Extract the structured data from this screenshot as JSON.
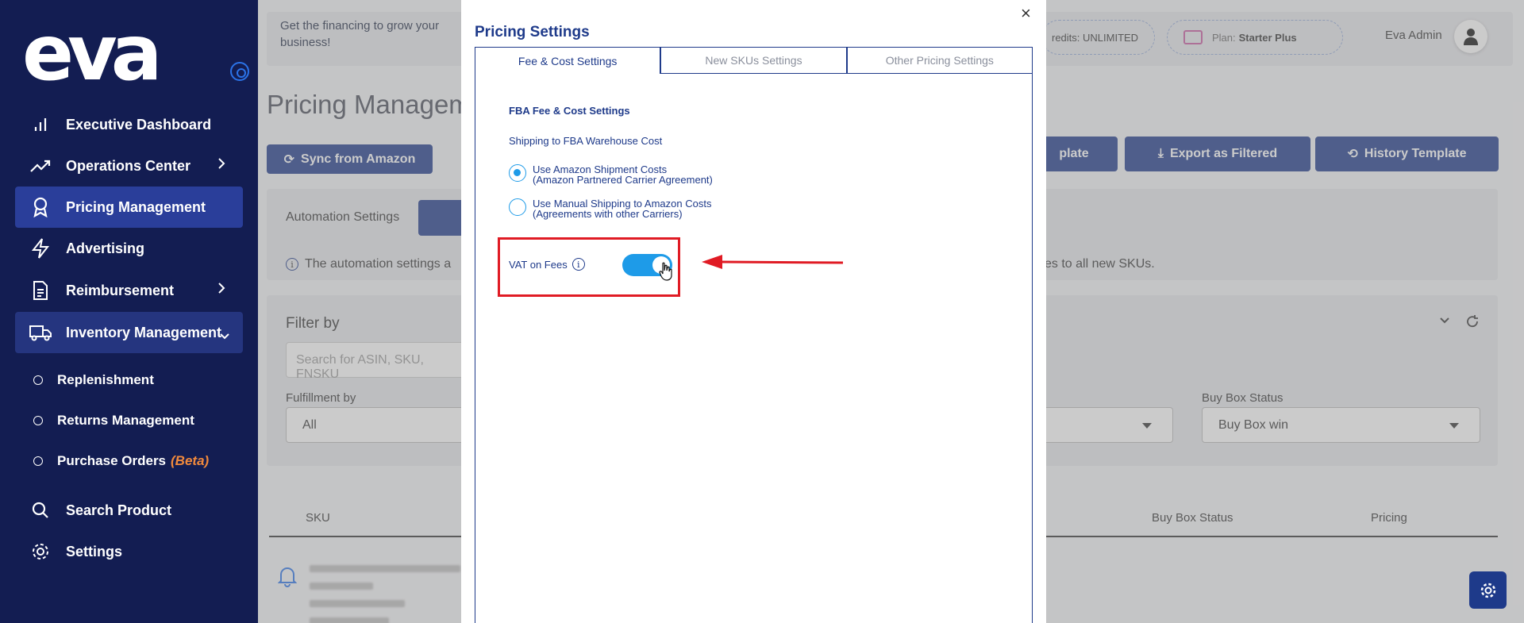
{
  "sidebar": {
    "logo_text": "eva",
    "items": [
      {
        "label": "Executive Dashboard",
        "icon": "bar-chart-icon"
      },
      {
        "label": "Operations Center",
        "icon": "trend-icon"
      },
      {
        "label": "Pricing Management",
        "icon": "award-icon"
      },
      {
        "label": "Advertising",
        "icon": "lightning-icon"
      },
      {
        "label": "Reimbursement",
        "icon": "document-icon"
      },
      {
        "label": "Inventory Management",
        "icon": "truck-icon"
      }
    ],
    "sub_items": [
      {
        "label": "Replenishment"
      },
      {
        "label": "Returns Management"
      },
      {
        "label": "Purchase Orders",
        "badge": "(Beta)"
      }
    ],
    "bottom_items": [
      {
        "label": "Search Product",
        "icon": "search-icon"
      },
      {
        "label": "Settings",
        "icon": "gear-icon"
      }
    ]
  },
  "header": {
    "promo": "Get the financing to grow your business!",
    "credits": "redits: UNLIMITED",
    "plan_label": "Plan:",
    "plan_value": "Starter Plus",
    "user_name": "Eva Admin"
  },
  "page": {
    "title": "Pricing Manageme",
    "sync_button": "Sync from Amazon",
    "template_button": "plate",
    "export_button": "Export as Filtered",
    "history_button": "History Template",
    "automation_label": "Automation Settings",
    "automation_info": "The automation settings a",
    "automation_info_right": "es to all new SKUs.",
    "filter_title": "Filter by",
    "search_placeholder": "Search for ASIN, SKU, FNSKU",
    "fulfillment_label": "Fulfillment by",
    "fulfillment_value": "All",
    "buybox_label": "Buy Box Status",
    "buybox_value": "Buy Box win",
    "table_headers": {
      "sku": "SKU",
      "buybox": "Buy Box Status",
      "pricing": "Pricing"
    }
  },
  "modal": {
    "title": "Pricing Settings",
    "close": "×",
    "tabs": [
      "Fee & Cost Settings",
      "New SKUs Settings",
      "Other Pricing Settings"
    ],
    "section_title": "FBA Fee & Cost Settings",
    "sub_title": "Shipping to FBA Warehouse Cost",
    "options": [
      {
        "line1": "Use Amazon Shipment Costs",
        "line2": "(Amazon Partnered Carrier Agreement)",
        "checked": true
      },
      {
        "line1": "Use Manual Shipping to Amazon Costs",
        "line2": "(Agreements with other Carriers)",
        "checked": false
      }
    ],
    "vat_label": "VAT on Fees",
    "vat_enabled": true
  },
  "colors": {
    "sidebar": "#131d52",
    "accent": "#1e3a8a",
    "toggle": "#1e9be8",
    "highlight": "#e01b24"
  }
}
